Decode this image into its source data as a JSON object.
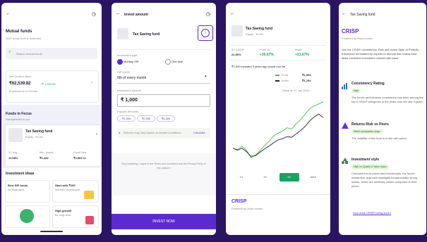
{
  "screen1": {
    "title": "Mutual funds",
    "subtitle": "3507 funds from a Schemes",
    "search_placeholder": "Search mutual funds",
    "portfolio": {
      "label": "Net Current Value",
      "value": "₹62,539.82",
      "badge": "+₹ 1,200.56",
      "note": "Investments in 3 funds"
    },
    "focus": {
      "title": "Funds in Focus",
      "subtitle": "Handpicked for you"
    },
    "fund_card": {
      "name": "Tax Saving fund",
      "sub": "Equity · ELSS",
      "stats": [
        {
          "label": "3Y Avg",
          "value": "11.68%"
        },
        {
          "label": "Min. Invest.",
          "value": "₹1,000"
        },
        {
          "label": "Fund Size",
          "value": "₹4,569 Cr"
        }
      ]
    },
    "ideas": {
      "title": "Investment ideas",
      "items": [
        {
          "label": "Best SIP funds",
          "sub": "for beginners"
        },
        {
          "label": "Start with ₹100",
          "sub": "low min. investment"
        },
        {
          "label": "",
          "sub": ""
        },
        {
          "label": "High growth",
          "sub": "for long term"
        }
      ]
    }
  },
  "screen2": {
    "header": "Invest amount",
    "fund_name": "Tax Saving fund",
    "investment_type_label": "Investment type",
    "options": [
      "Monthly SIP",
      "One time"
    ],
    "sip_date_label": "SIP DATE",
    "sip_date_value": "5th of every month",
    "amount_label": "Investment amount",
    "amount_value": "₹ 1,000",
    "chips_label": "Popular amounts",
    "chips": [
      "₹1,000",
      "₹2,000",
      "₹5,000"
    ],
    "info": "Returns may vary based on market conditions",
    "info_link": "Calculate",
    "disclaimer": "By proceeding, I agree to the Terms and Conditions and the Privacy Policy of this platform",
    "cta": "INVEST NOW"
  },
  "screen3": {
    "fund_name": "Tax Saving fund",
    "fund_sub": "Equity · ELSS",
    "metric_a": {
      "label": "3Y CAGR",
      "value": "21.50%"
    },
    "metric_b": {
      "label": "Fund vs",
      "value": "+30.67%"
    },
    "metric_c": {
      "label": "Index",
      "value": "+21.67%"
    },
    "chart_caption": "₹1,000 invested 3 years ago would now be",
    "legend": [
      {
        "label": "Fund",
        "value": "₹1,906",
        "color": "#3fbf5a"
      },
      {
        "label": "Index",
        "value": "₹1,760",
        "color": "#222222"
      }
    ],
    "value_on": "Value on 11 Jan 2024",
    "timeframes": [
      "1Y",
      "3Y",
      "5Y",
      "MAX"
    ],
    "selected_timeframe": "5Y",
    "crisp_label": "CRISP",
    "crisp_sub": "Powered by dhan.moden",
    "chart_data": {
      "type": "line",
      "x": [
        0,
        1,
        2,
        3,
        4,
        5,
        6,
        7,
        8,
        9,
        10,
        11,
        12,
        13,
        14,
        15,
        16,
        17,
        18,
        19,
        20
      ],
      "series": [
        {
          "name": "Fund",
          "values": [
            100,
            98,
            103,
            97,
            86,
            90,
            96,
            104,
            110,
            118,
            122,
            125,
            130,
            128,
            136,
            142,
            150,
            158,
            162,
            165,
            168
          ]
        },
        {
          "name": "Index",
          "values": [
            100,
            97,
            100,
            95,
            88,
            89,
            94,
            99,
            103,
            108,
            112,
            114,
            117,
            116,
            121,
            126,
            132,
            140,
            146,
            150,
            145
          ]
        }
      ],
      "title": "",
      "xlabel": "",
      "ylabel": "",
      "ylim": [
        80,
        175
      ],
      "grid": false
    }
  },
  "screen4": {
    "header": "Tax Saving fund",
    "crisp_label": "CRISP",
    "crisp_sub": "Powered by dhan.moden",
    "intro": "Use the CRISP Consistency, Risk and Invest Style of Portfolio framework formulated by experts to decode this mutual fund. Make confident investment choices with ease.",
    "sections": [
      {
        "title": "Consistency Rating",
        "tag": "High",
        "text": "The fund's performance consistency has been among the top 5 CRISP categories in the years over the last 3 years.",
        "icon": "bar-chart-icon",
        "color": "#2b6fd6"
      },
      {
        "title": "Returns Risk vs Peers",
        "tag": "Within acceptable range",
        "text": "The volatility of this fund is in line with peers.",
        "icon": "triangle-warning-icon",
        "color": "#6d2fd6"
      },
      {
        "title": "Investment style",
        "tag": "High on Quality & Value factor",
        "text": "Compared to its peers and benchmarks, the fund's investment approach highlights fundamentally strong stocks, which are relatively valued compared to their peers.",
        "icon": "shapes-icon",
        "color": "#3a8a3a"
      }
    ],
    "link": "How does CRISP rating work?"
  }
}
